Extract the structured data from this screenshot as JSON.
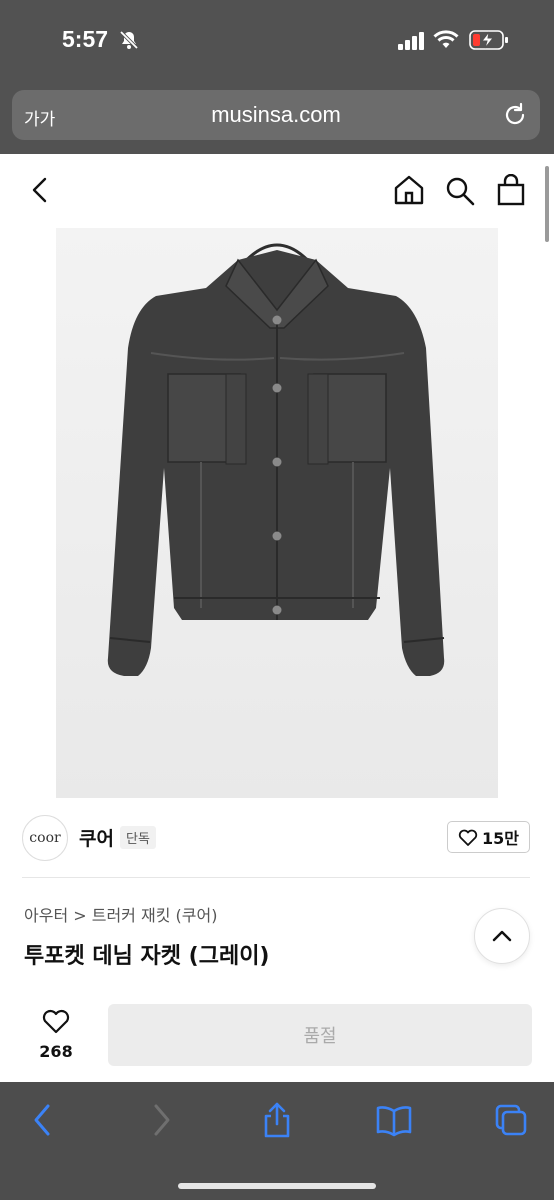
{
  "status_bar": {
    "time": "5:57"
  },
  "browser": {
    "text_size_label": "가가",
    "url": "musinsa.com"
  },
  "brand": {
    "logo_text": "coor",
    "name": "쿠어",
    "badge": "단독",
    "likes": "15만"
  },
  "product": {
    "category": "아우터 > 트러커 재킷 (쿠어)",
    "title": "투포켓 데님 자켓 (그레이)"
  },
  "actions": {
    "wish_count": "268",
    "buy_label": "품절"
  },
  "colors": {
    "chrome": "#525252",
    "toolbar_blue": "#3b82f6"
  }
}
